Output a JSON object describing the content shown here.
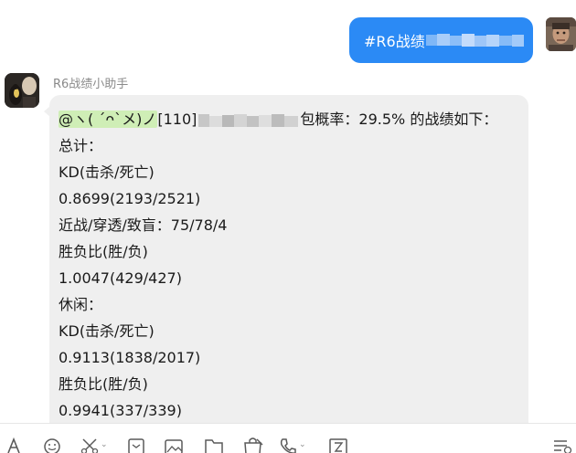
{
  "outgoing": {
    "text": "#R6战绩"
  },
  "incoming": {
    "sender": "R6战绩小助手",
    "mention": "@ヽ( ´ᴖ`メ)ノ",
    "header_level": "[110]",
    "header_rest": "包概率：29.5% 的战绩如下：",
    "lines": [
      "总计：",
      "KD(击杀/死亡)",
      "0.8699(2193/2521)",
      "近战/穿透/致盲：75/78/4",
      "胜负比(胜/负)",
      "1.0047(429/427)",
      "休闲：",
      "KD(击杀/死亡)",
      "0.9113(1838/2017)",
      "胜负比(胜/负)",
      "0.9941(337/339)"
    ]
  },
  "toolbar": {
    "icons": [
      "font-icon",
      "emoji-icon",
      "scissors-icon",
      "shake-icon",
      "image-icon",
      "folder-icon",
      "bag-icon",
      "phone-icon",
      "video-icon",
      "history-icon"
    ]
  },
  "colors": {
    "outgoing_bubble": "#2b8af5",
    "incoming_bubble": "#efefef",
    "mention_highlight": "#cfeeb6"
  }
}
